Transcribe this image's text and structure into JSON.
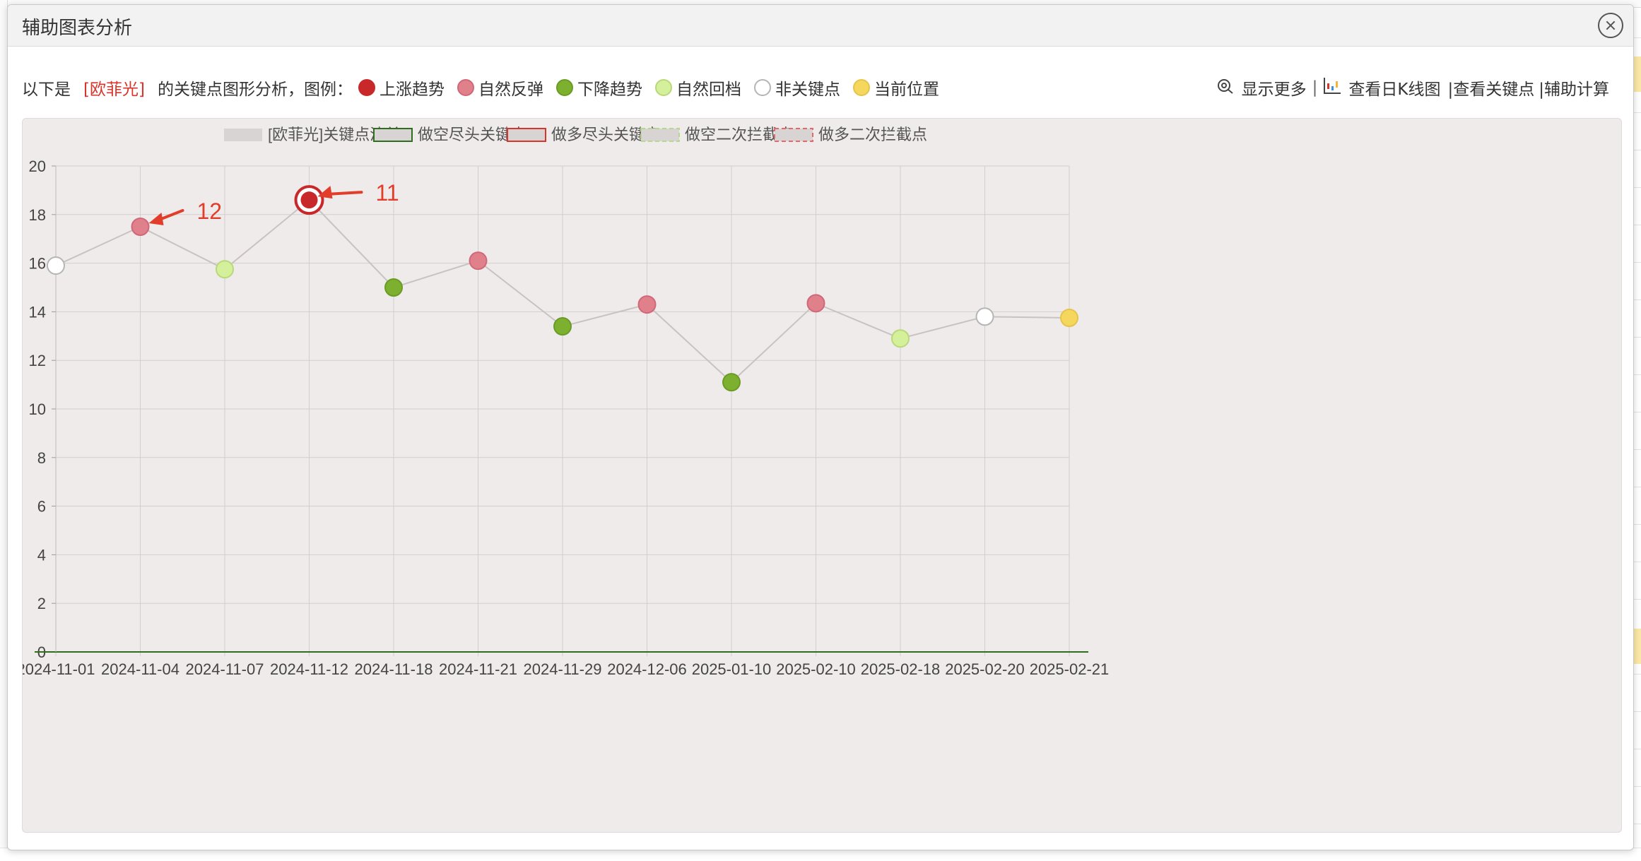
{
  "dialog": {
    "title": "辅助图表分析",
    "info_prefix": "以下是",
    "stock_name": "[欧菲光]",
    "info_suffix": "的关键点图形分析，图例：",
    "legend": [
      {
        "label": "上涨趋势",
        "color": "#c8282a",
        "border": "#c8282a"
      },
      {
        "label": "自然反弹",
        "color": "#e0808a",
        "border": "#d06878"
      },
      {
        "label": "下降趋势",
        "color": "#7cb02e",
        "border": "#6a9c25"
      },
      {
        "label": "自然回档",
        "color": "#d5f09a",
        "border": "#b8d87a"
      },
      {
        "label": "非关键点",
        "color": "#ffffff",
        "border": "#b5b5b5"
      },
      {
        "label": "当前位置",
        "color": "#f6d75e",
        "border": "#e6c44a"
      }
    ],
    "links": {
      "show_more": "显示更多",
      "daily_k": "查看日K线图",
      "view_keypoints": "|查看关键点",
      "assist_calc": "|辅助计算"
    }
  },
  "chart_data": {
    "type": "line",
    "legend": [
      {
        "label": "[欧菲光]关键点清单",
        "style": "solid-gray"
      },
      {
        "label": "做空尽头关键点",
        "style": "green-border"
      },
      {
        "label": "做多尽头关键点",
        "style": "red-border"
      },
      {
        "label": "做空二次拦截点",
        "style": "green-dashed"
      },
      {
        "label": "做多二次拦截点",
        "style": "red-dashed"
      }
    ],
    "categories": [
      "2024-11-01",
      "2024-11-04",
      "2024-11-07",
      "2024-11-12",
      "2024-11-18",
      "2024-11-21",
      "2024-11-29",
      "2024-12-06",
      "2025-01-10",
      "2025-02-10",
      "2025-02-18",
      "2025-02-20",
      "2025-02-21"
    ],
    "values": [
      15.9,
      17.5,
      15.75,
      18.6,
      15.0,
      16.1,
      13.4,
      14.3,
      11.1,
      14.35,
      12.9,
      13.8,
      13.75
    ],
    "point_types": [
      "非关键点",
      "自然反弹",
      "自然回档",
      "上涨趋势",
      "下降趋势",
      "自然反弹",
      "下降趋势",
      "自然反弹",
      "下降趋势",
      "自然反弹",
      "自然回档",
      "非关键点",
      "当前位置"
    ],
    "ylim": [
      0,
      20
    ],
    "yticks": [
      0,
      2,
      4,
      6,
      8,
      10,
      12,
      14,
      16,
      18,
      20
    ],
    "grid": true,
    "annotations": [
      {
        "label": "12",
        "category": "2024-11-04"
      },
      {
        "label": "11",
        "category": "2024-11-12"
      }
    ]
  }
}
